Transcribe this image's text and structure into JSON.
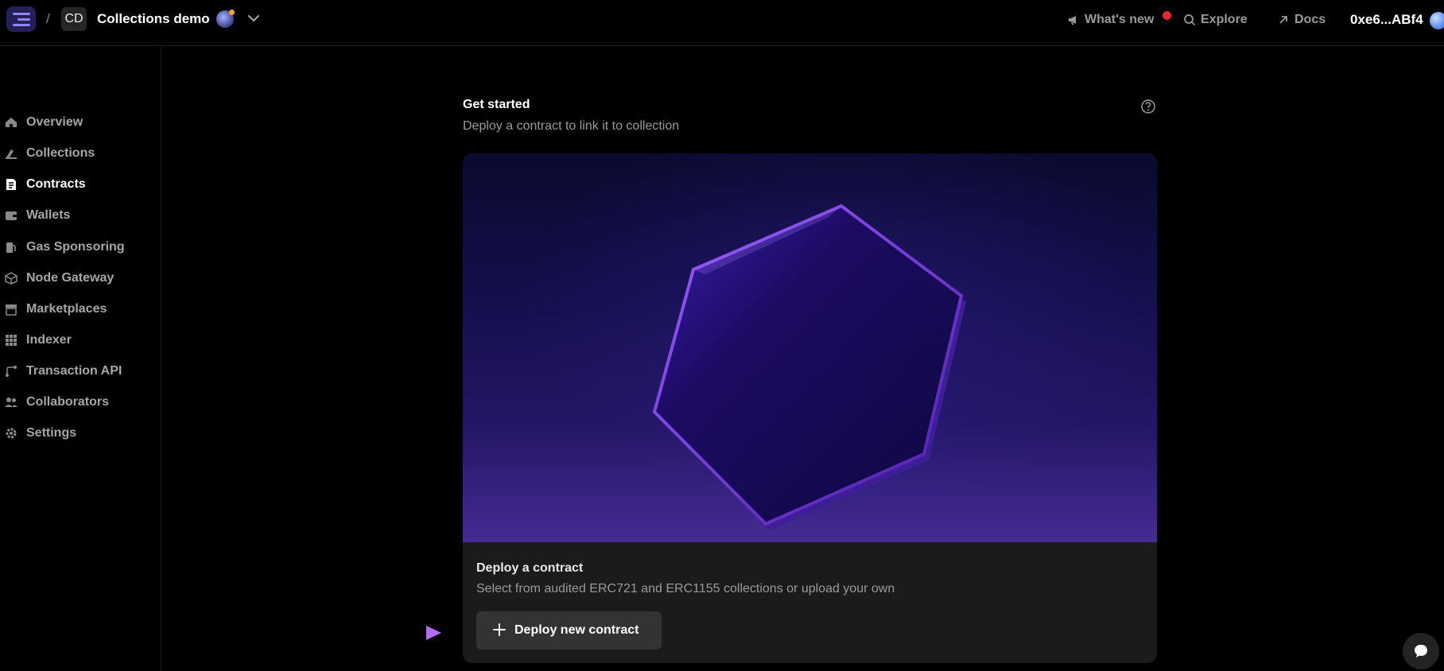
{
  "header": {
    "logo_icon": "menu-logo-icon",
    "separator": "/",
    "project_initials": "CD",
    "project_name": "Collections demo",
    "network_icon": "network-icon",
    "whats_new": "What's new",
    "explore": "Explore",
    "docs": "Docs",
    "address": "0xe6...ABf4"
  },
  "sidebar": {
    "items": [
      {
        "label": "Overview",
        "icon": "home-icon",
        "active": false
      },
      {
        "label": "Collections",
        "icon": "collections-icon",
        "active": false
      },
      {
        "label": "Contracts",
        "icon": "contract-icon",
        "active": true
      },
      {
        "label": "Wallets",
        "icon": "wallet-icon",
        "active": false
      },
      {
        "label": "Gas Sponsoring",
        "icon": "gas-pump-icon",
        "active": false
      },
      {
        "label": "Node Gateway",
        "icon": "cube-icon",
        "active": false
      },
      {
        "label": "Marketplaces",
        "icon": "store-icon",
        "active": false
      },
      {
        "label": "Indexer",
        "icon": "grid-icon",
        "active": false
      },
      {
        "label": "Transaction API",
        "icon": "route-icon",
        "active": false
      },
      {
        "label": "Collaborators",
        "icon": "users-icon",
        "active": false
      },
      {
        "label": "Settings",
        "icon": "gear-icon",
        "active": false
      }
    ]
  },
  "main": {
    "title": "Get started",
    "subtitle": "Deploy a contract to link it to collection",
    "card": {
      "title": "Deploy a contract",
      "description": "Select from audited ERC721 and ERC1155 collections or upload your own",
      "button_label": "Deploy new contract"
    }
  },
  "colors": {
    "accent": "#8d84ff",
    "badge_red": "#e1272a",
    "arrow_start": "#5a55d6",
    "arrow_end": "#b36cf2"
  }
}
